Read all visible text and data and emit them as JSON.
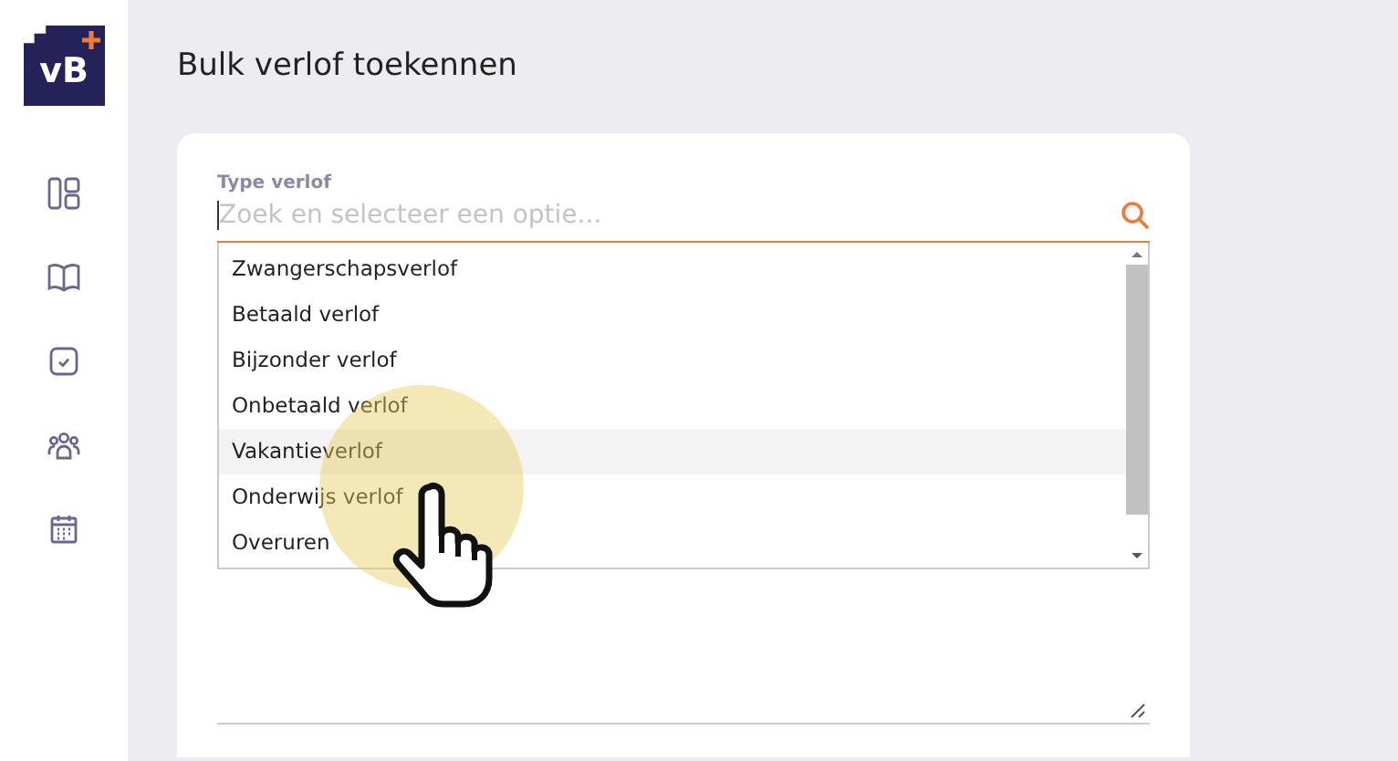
{
  "logo": {
    "text": "vB"
  },
  "nav": [
    {
      "kind": "dashboard",
      "selected": false
    },
    {
      "kind": "book",
      "selected": false
    },
    {
      "kind": "check",
      "selected": false
    },
    {
      "kind": "people",
      "selected": false
    },
    {
      "kind": "calendar",
      "selected": false
    }
  ],
  "page_title": "Bulk verlof toekennen",
  "field": {
    "label": "Type verlof",
    "placeholder": "Zoek en selecteer een optie..."
  },
  "options": [
    {
      "label": "Zwangerschapsverlof",
      "selected": false
    },
    {
      "label": "Betaald verlof",
      "selected": false
    },
    {
      "label": "Bijzonder verlof",
      "selected": false
    },
    {
      "label": "Onbetaald verlof",
      "selected": false
    },
    {
      "label": "Vakantieverlof",
      "selected": true
    },
    {
      "label": "Onderwijs verlof",
      "selected": false
    },
    {
      "label": "Overuren",
      "selected": false
    }
  ]
}
